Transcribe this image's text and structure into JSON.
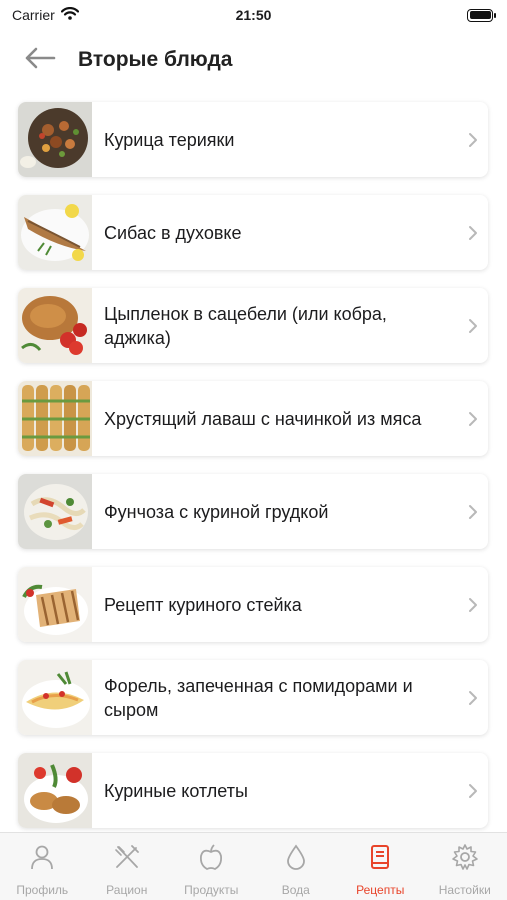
{
  "status_bar": {
    "carrier": "Carrier",
    "time": "21:50"
  },
  "header": {
    "title": "Вторые блюда",
    "back_icon": "arrow-left-icon"
  },
  "recipes": [
    {
      "title": "Курица терияки"
    },
    {
      "title": "Сибас в духовке"
    },
    {
      "title": "Цыпленок в сацебели (или кобра, аджика)"
    },
    {
      "title": "Хрустящий лаваш с начинкой из мяса"
    },
    {
      "title": "Фунчоза с куриной грудкой"
    },
    {
      "title": "Рецепт куриного стейка"
    },
    {
      "title": "Форель, запеченная с помидорами и сыром"
    },
    {
      "title": "Куриные котлеты"
    }
  ],
  "tab_bar": {
    "active": "recipes",
    "active_color": "#e8442a",
    "inactive_color": "#a7a7a7",
    "tabs": [
      {
        "id": "profile",
        "label": "Профиль",
        "icon": "person-icon"
      },
      {
        "id": "diet",
        "label": "Рацион",
        "icon": "fork-knife-icon"
      },
      {
        "id": "products",
        "label": "Продукты",
        "icon": "apple-icon"
      },
      {
        "id": "water",
        "label": "Вода",
        "icon": "water-drop-icon"
      },
      {
        "id": "recipes",
        "label": "Рецепты",
        "icon": "book-icon"
      },
      {
        "id": "settings",
        "label": "Настойки",
        "icon": "gear-icon"
      }
    ]
  }
}
